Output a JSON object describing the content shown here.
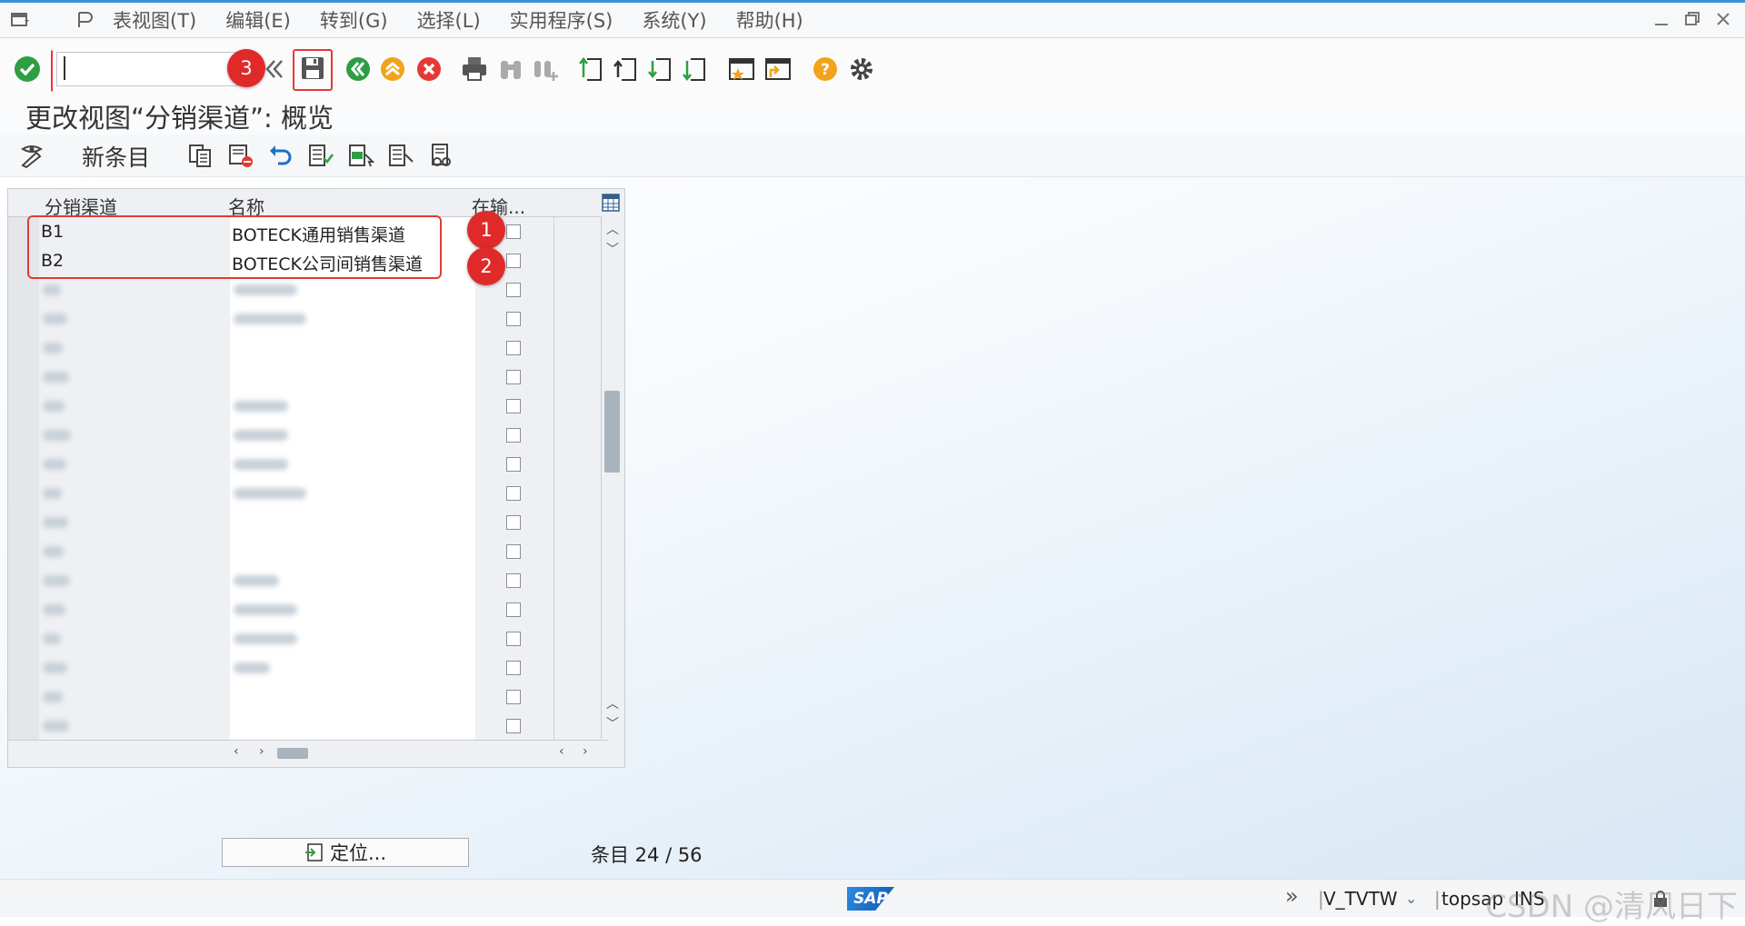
{
  "menu": {
    "items": [
      "表视图(T)",
      "编辑(E)",
      "转到(G)",
      "选择(L)",
      "实用程序(S)",
      "系统(Y)",
      "帮助(H)"
    ]
  },
  "toolbar": {
    "command_value": "",
    "icons": [
      "enter-check-icon",
      "command-field",
      "expand-chevron-icon",
      "save-icon",
      "back-icon",
      "exit-icon",
      "cancel-icon",
      "print-icon",
      "find-icon",
      "find-next-icon",
      "first-page-icon",
      "previous-page-icon",
      "next-page-icon",
      "last-page-icon",
      "create-session-icon",
      "shortcut-icon",
      "help-icon",
      "settings-icon"
    ]
  },
  "annotations": {
    "badge_1": "1",
    "badge_2": "2",
    "badge_3": "3"
  },
  "title": "更改视图“分销渠道”: 概览",
  "app_toolbar": {
    "new_entries": "新条目"
  },
  "table": {
    "columns": [
      "分销渠道",
      "名称",
      "在输..."
    ],
    "rows": [
      {
        "code": "B1",
        "name": "BOTECK通用销售渠道",
        "checked": false
      },
      {
        "code": "B2",
        "name": "BOTECK公司间销售渠道",
        "checked": false
      }
    ],
    "blurred_row_count": 16
  },
  "footer": {
    "position_button": "定位...",
    "entries_label": "条目 24 / 56"
  },
  "status": {
    "sap_logo": "SAP",
    "transaction": "V_TVTW",
    "server": "topsap",
    "mode": "INS",
    "watermark": "CSDN @清风日下"
  },
  "colors": {
    "accent_red": "#e53935",
    "badge_red": "#e02a2a",
    "ok_green": "#2e9e44",
    "warn_orange": "#f2a31b",
    "sap_blue": "#0d57b0"
  }
}
